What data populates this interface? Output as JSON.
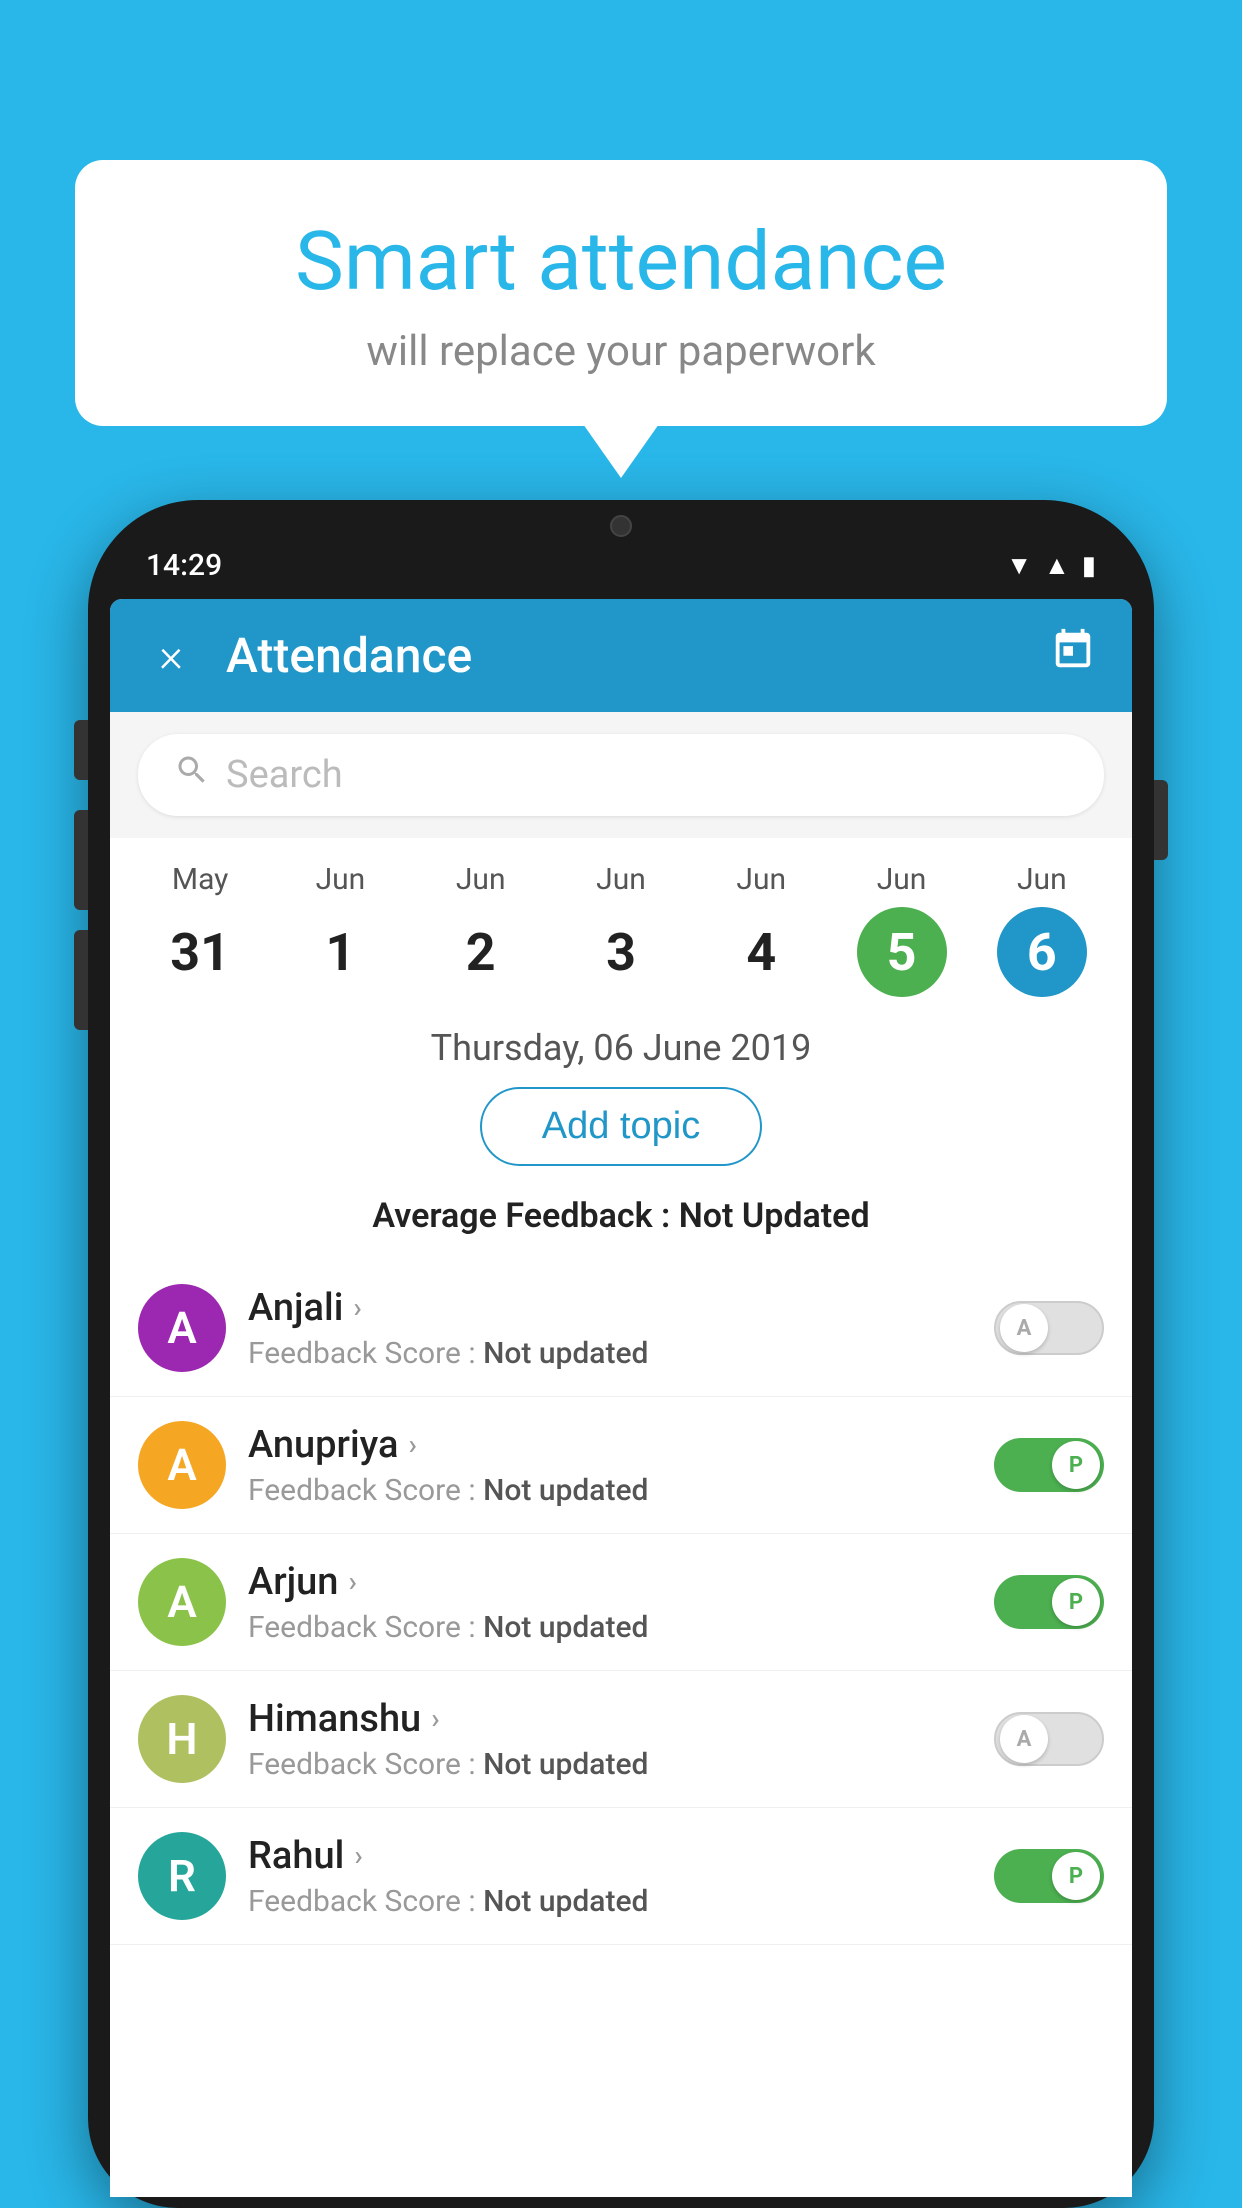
{
  "background_color": "#29b6e8",
  "speech_bubble": {
    "title": "Smart attendance",
    "subtitle": "will replace your paperwork"
  },
  "status_bar": {
    "time": "14:29",
    "icons": [
      "wifi",
      "signal",
      "battery"
    ]
  },
  "header": {
    "title": "Attendance",
    "close_label": "×",
    "calendar_label": "📅"
  },
  "search": {
    "placeholder": "Search"
  },
  "calendar": {
    "days": [
      {
        "month": "May",
        "num": "31",
        "highlight": ""
      },
      {
        "month": "Jun",
        "num": "1",
        "highlight": ""
      },
      {
        "month": "Jun",
        "num": "2",
        "highlight": ""
      },
      {
        "month": "Jun",
        "num": "3",
        "highlight": ""
      },
      {
        "month": "Jun",
        "num": "4",
        "highlight": ""
      },
      {
        "month": "Jun",
        "num": "5",
        "highlight": "green"
      },
      {
        "month": "Jun",
        "num": "6",
        "highlight": "blue"
      }
    ]
  },
  "selected_date": "Thursday, 06 June 2019",
  "add_topic_label": "Add topic",
  "avg_feedback_label": "Average Feedback : ",
  "avg_feedback_value": "Not Updated",
  "students": [
    {
      "name": "Anjali",
      "initial": "A",
      "avatar_class": "avatar-purple",
      "feedback_label": "Feedback Score : ",
      "feedback_value": "Not updated",
      "toggle_state": "off",
      "toggle_letter": "A"
    },
    {
      "name": "Anupriya",
      "initial": "A",
      "avatar_class": "avatar-orange",
      "feedback_label": "Feedback Score : ",
      "feedback_value": "Not updated",
      "toggle_state": "on",
      "toggle_letter": "P"
    },
    {
      "name": "Arjun",
      "initial": "A",
      "avatar_class": "avatar-light-green",
      "feedback_label": "Feedback Score : ",
      "feedback_value": "Not updated",
      "toggle_state": "on",
      "toggle_letter": "P"
    },
    {
      "name": "Himanshu",
      "initial": "H",
      "avatar_class": "avatar-olive",
      "feedback_label": "Feedback Score : ",
      "feedback_value": "Not updated",
      "toggle_state": "off",
      "toggle_letter": "A"
    },
    {
      "name": "Rahul",
      "initial": "R",
      "avatar_class": "avatar-teal",
      "feedback_label": "Feedback Score : ",
      "feedback_value": "Not updated",
      "toggle_state": "on",
      "toggle_letter": "P"
    }
  ]
}
